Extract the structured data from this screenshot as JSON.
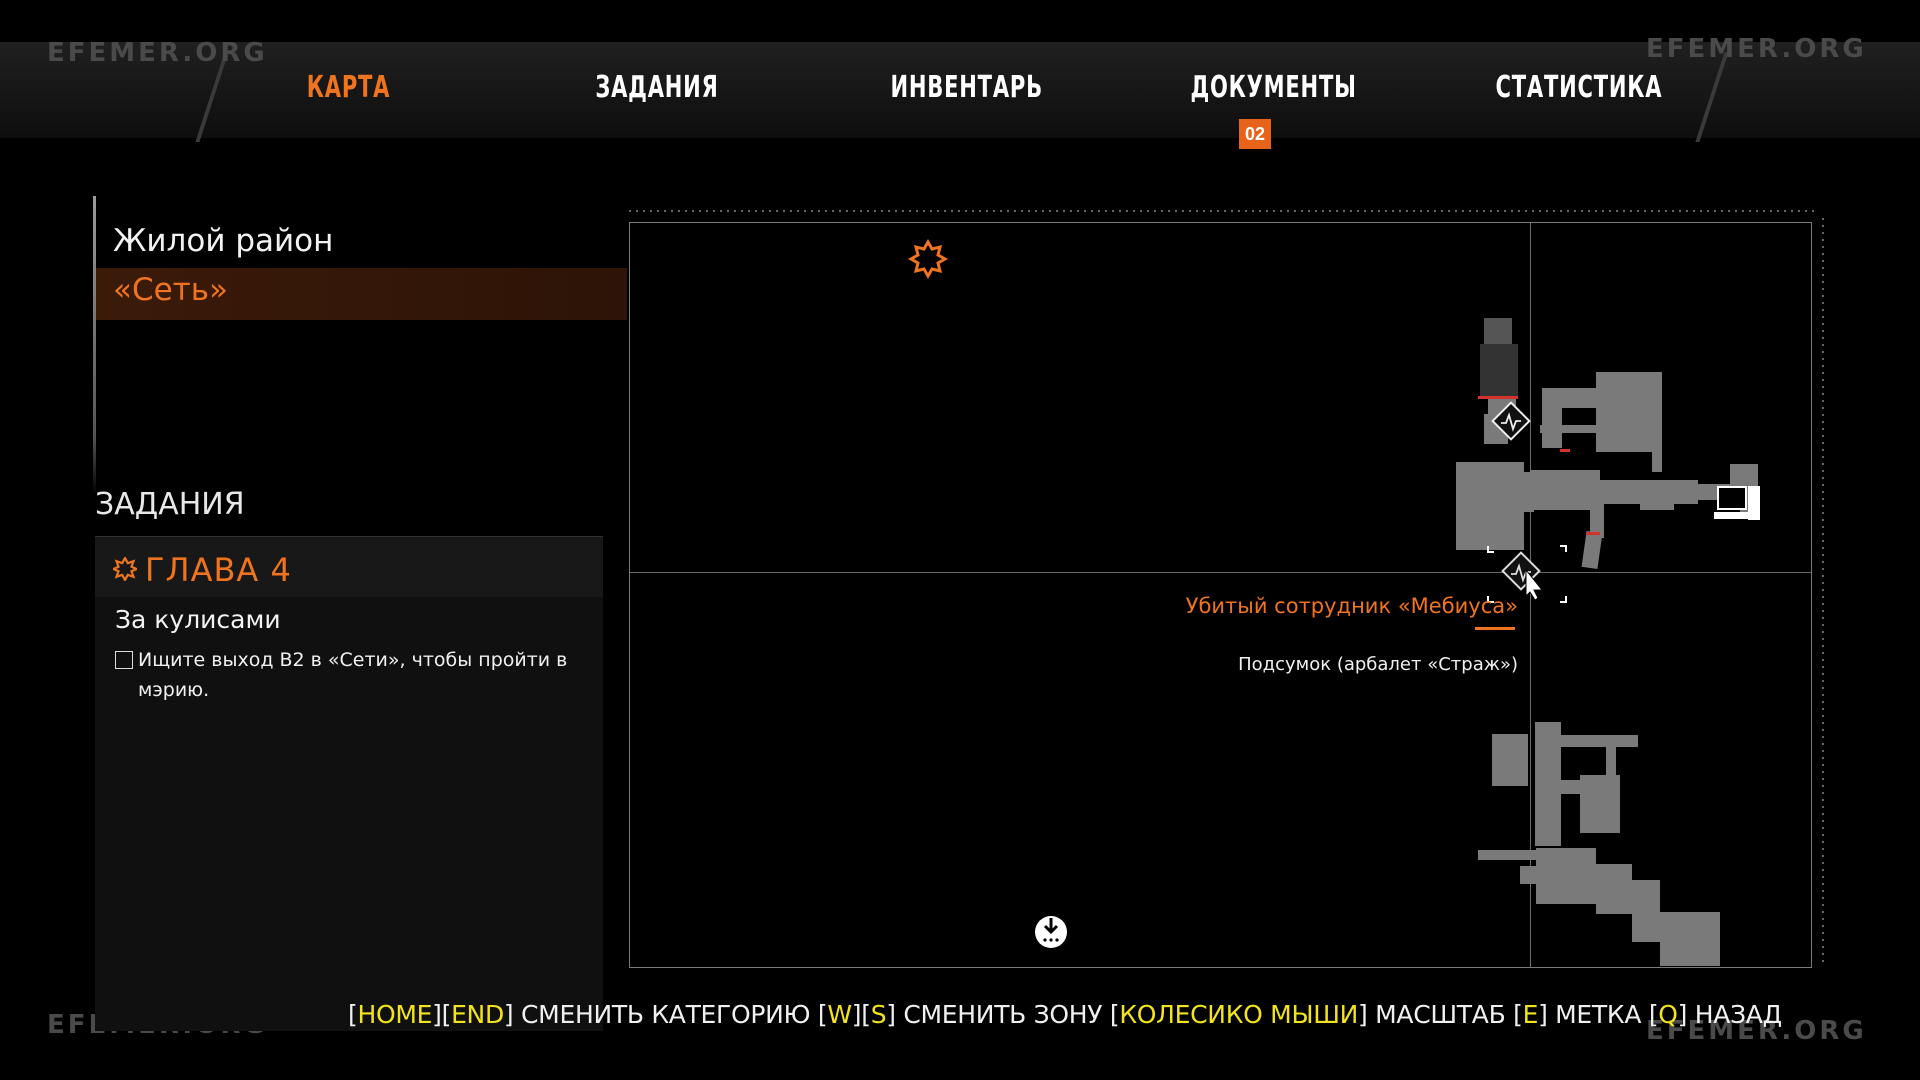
{
  "watermark": "EFEMER.ORG",
  "tabs": [
    {
      "label": "КАРТА",
      "active": true
    },
    {
      "label": "ЗАДАНИЯ",
      "active": false
    },
    {
      "label": "ИНВЕНТАРЬ",
      "active": false
    },
    {
      "label": "ДОКУМЕНТЫ",
      "active": false,
      "badge": "02"
    },
    {
      "label": "СТАТИСТИКА",
      "active": false
    }
  ],
  "regions": [
    {
      "label": "Жилой район",
      "selected": false
    },
    {
      "label": "«Сеть»",
      "selected": true
    }
  ],
  "tasks": {
    "heading": "ЗАДАНИЯ",
    "chapter": "ГЛАВА  4",
    "quest_name": "За кулисами",
    "objective": "Ищите выход В2 в «Сети», чтобы пройти в мэрию."
  },
  "map": {
    "selected_label": "Убитый сотрудник «Мебиуса»",
    "selected_sublabel": "Подсумок (арбалет «Страж»)",
    "icons": [
      "objective-star-icon",
      "save-point-icon",
      "terminal-icon",
      "cursor-marker-icon",
      "waypoint-icon"
    ]
  },
  "hints": [
    {
      "pre": "[",
      "key": "HOME",
      "post": "]"
    },
    {
      "pre": "[",
      "key": "END",
      "post": "] СМЕНИТЬ КАТЕГОРИЮ "
    },
    {
      "pre": "[",
      "key": "W",
      "post": "]"
    },
    {
      "pre": "[",
      "key": "S",
      "post": "] СМЕНИТЬ ЗОНУ "
    },
    {
      "pre": "[",
      "key": "КОЛЕСИКО МЫШИ",
      "post": "] МАСШТАБ "
    },
    {
      "pre": "[",
      "key": "E",
      "post": "] МЕТКА "
    },
    {
      "pre": "[",
      "key": "Q",
      "post": "] НАЗАД"
    }
  ],
  "colors": {
    "accent": "#f0741d",
    "key": "#f2e31b",
    "map_room": "#7a7a7a"
  }
}
